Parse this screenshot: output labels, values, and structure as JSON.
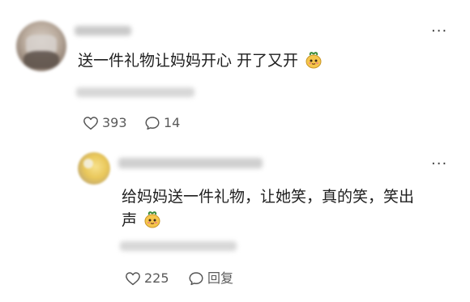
{
  "comment": {
    "text": "送一件礼物让妈妈开心 开了又开",
    "emoji": "mango-emoji",
    "likes": "393",
    "replies": "14",
    "more_label": "···"
  },
  "reply": {
    "text_line1": "给妈妈送一件礼物，让她笑，真的笑，笑出",
    "text_line2": "声",
    "emoji": "mango-emoji",
    "likes": "225",
    "reply_label": "回复",
    "more_label": "···"
  }
}
